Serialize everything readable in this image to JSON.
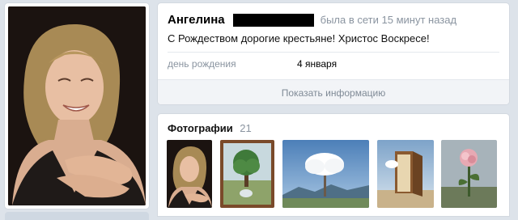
{
  "profile": {
    "name": "Ангелина",
    "last_seen": "была в сети 15 минут назад",
    "status": "С Рождеством дорогие крестьяне! Христос Воскресе!",
    "birthday_label": "день рождения",
    "birthday_value": "4 января",
    "show_info_label": "Показать информацию"
  },
  "photos": {
    "title": "Фотографии",
    "count": "21",
    "items": [
      {
        "icon": "portrait-photo"
      },
      {
        "icon": "tree-painting-photo"
      },
      {
        "icon": "cloud-tree-painting-photo"
      },
      {
        "icon": "door-painting-photo"
      },
      {
        "icon": "rose-painting-photo"
      }
    ]
  },
  "colors": {
    "background": "#dde3ea",
    "card": "#ffffff",
    "muted_text": "#8a94a0",
    "button_bg": "#f2f4f7"
  }
}
